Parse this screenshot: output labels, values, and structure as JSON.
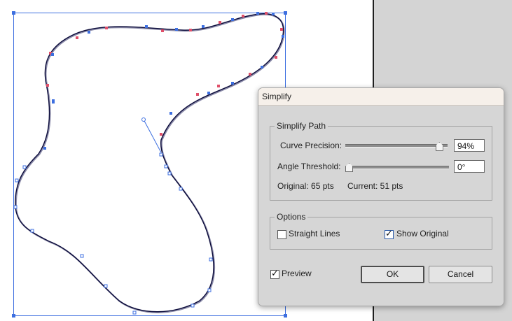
{
  "dialog": {
    "title": "Simplify",
    "simplify_path": {
      "legend": "Simplify Path",
      "curve_precision": {
        "label": "Curve Precision:",
        "value": "94%",
        "slider_fraction": 0.94
      },
      "angle_threshold": {
        "label": "Angle Threshold:",
        "value": "0°",
        "slider_fraction": 0.0
      },
      "original_points": "Original: 65 pts",
      "current_points": "Current: 51 pts"
    },
    "options": {
      "legend": "Options",
      "straight_lines": {
        "label": "Straight Lines",
        "checked": false
      },
      "show_original": {
        "label": "Show Original",
        "checked": true
      }
    },
    "preview": {
      "label": "Preview",
      "checked": true
    },
    "ok_label": "OK",
    "cancel_label": "Cancel"
  },
  "colors": {
    "path_stroke": "#0b0b3a",
    "selection_blue": "#3d6fe0",
    "original_points_red": "#e0506a",
    "pasteboard": "#d4d4d4",
    "dialog_bg": "#d6d6d6"
  }
}
